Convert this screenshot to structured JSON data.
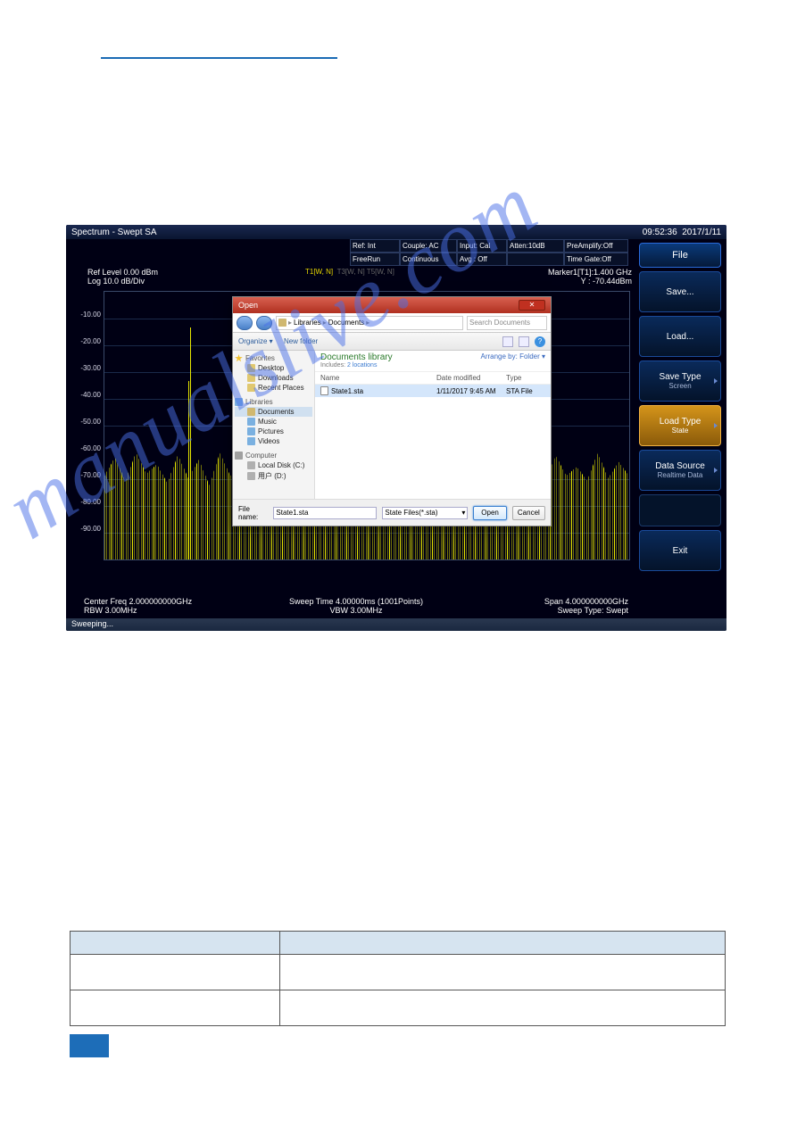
{
  "titlebar": {
    "title": "Spectrum - Swept SA",
    "time": "09:52:36",
    "date": "2017/1/11"
  },
  "status": {
    "ref": "Ref: Int",
    "couple": "Couple: AC",
    "input": "Input: Cal",
    "atten": "Atten:10dB",
    "preamp": "PreAmplify:Off",
    "trig": "FreeRun",
    "sweep": "Continuous",
    "avg": "Avg : Off",
    "gate_blank": "",
    "timegate": "Time Gate:Off"
  },
  "side": {
    "title": "File",
    "save": "Save...",
    "load": "Load...",
    "savetype": "Save Type",
    "savetype_sub": "Screen",
    "loadtype": "Load Type",
    "loadtype_sub": "State",
    "datasrc": "Data Source",
    "datasrc_sub": "Realtime Data",
    "exit": "Exit"
  },
  "plot": {
    "ref": "Ref Level 0.00 dBm",
    "log": "Log 10.0 dB/Div",
    "traces": {
      "t1": "T1[W, N]",
      "t2": "T3[W, N]  T5[W, N]"
    },
    "marker_l1": "Marker1[T1]:1.400 GHz",
    "marker_l2": "Y : -70.44dBm",
    "ylabels": [
      "-10.00",
      "-20.00",
      "-30.00",
      "-40.00",
      "-50.00",
      "-60.00",
      "-70.00",
      "-80.00",
      "-90.00"
    ]
  },
  "bottom": {
    "cf": "Center Freq 2.000000000GHz",
    "rbw": "RBW 3.00MHz",
    "st": "Sweep Time 4.00000ms (1001Points)",
    "vbw": "VBW 3.00MHz",
    "span": "Span 4.000000000GHz",
    "stype": "Sweep Type: Swept"
  },
  "statusbar": "Sweeping...",
  "dialog": {
    "title": "Open",
    "crumb": {
      "p1": "Libraries",
      "p2": "Documents"
    },
    "search_ph": "Search Documents",
    "toolbar": {
      "organize": "Organize ▾",
      "newfolder": "New folder"
    },
    "sidebar": {
      "fav": "Favorites",
      "desktop": "Desktop",
      "downloads": "Downloads",
      "recent": "Recent Places",
      "lib": "Libraries",
      "docs": "Documents",
      "music": "Music",
      "pics": "Pictures",
      "vids": "Videos",
      "comp": "Computer",
      "cdrive": "Local Disk (C:)",
      "ddrive": "用户 (D:)"
    },
    "main": {
      "heading": "Documents library",
      "sub": "Includes:",
      "sub_link": "2 locations",
      "arrange": "Arrange by:",
      "arrange_val": "Folder ▾",
      "cols": {
        "name": "Name",
        "date": "Date modified",
        "type": "Type"
      },
      "row": {
        "name": "State1.sta",
        "date": "1/11/2017 9:45 AM",
        "type": "STA File"
      }
    },
    "bottom": {
      "label": "File name:",
      "value": "State1.sta",
      "filter": "State Files(*.sta)",
      "open": "Open",
      "cancel": "Cancel"
    }
  },
  "watermark": "manualslive.com",
  "table": {
    "head": {
      "c1": "",
      "c2": ""
    },
    "r1": {
      "c1": "",
      "c2": ""
    },
    "r2": {
      "c1": "",
      "c2": ""
    }
  }
}
